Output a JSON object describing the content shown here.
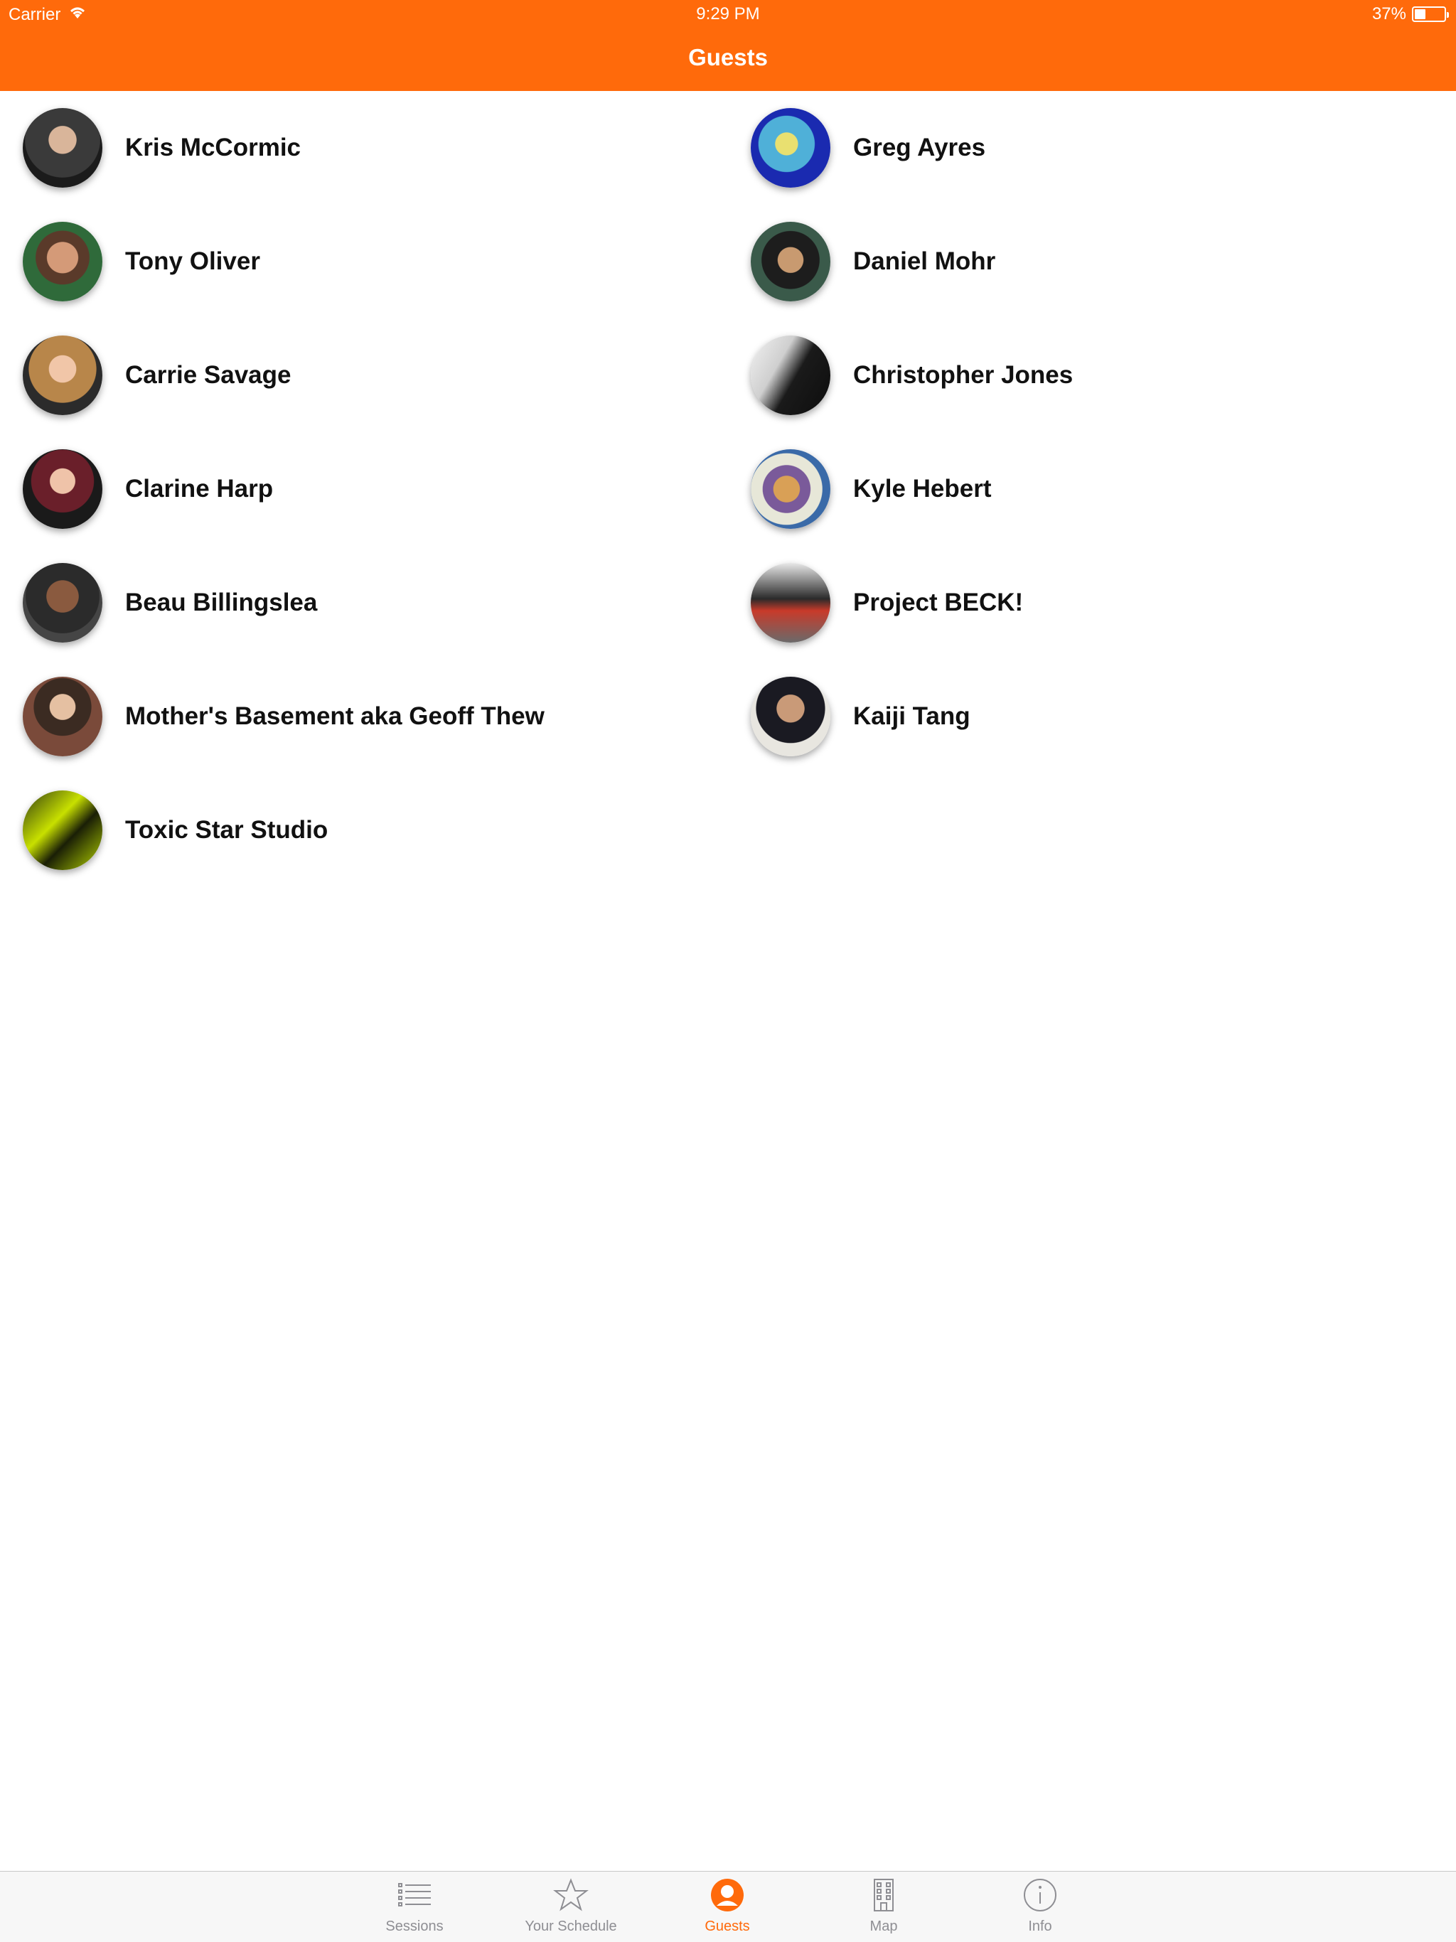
{
  "status_bar": {
    "carrier": "Carrier",
    "time": "9:29 PM",
    "battery": "37%"
  },
  "nav": {
    "title": "Guests"
  },
  "guests": [
    {
      "name": "Kris McCormic"
    },
    {
      "name": "Greg Ayres"
    },
    {
      "name": "Tony Oliver"
    },
    {
      "name": "Daniel Mohr"
    },
    {
      "name": "Carrie Savage"
    },
    {
      "name": "Christopher Jones"
    },
    {
      "name": "Clarine Harp"
    },
    {
      "name": "Kyle Hebert"
    },
    {
      "name": "Beau Billingslea"
    },
    {
      "name": "Project BECK!"
    },
    {
      "name": "Mother's Basement aka Geoff Thew"
    },
    {
      "name": "Kaiji Tang"
    },
    {
      "name": "Toxic Star Studio"
    }
  ],
  "tabs": [
    {
      "label": "Sessions",
      "icon": "list-icon"
    },
    {
      "label": "Your Schedule",
      "icon": "star-icon"
    },
    {
      "label": "Guests",
      "icon": "person-icon"
    },
    {
      "label": "Map",
      "icon": "building-icon"
    },
    {
      "label": "Info",
      "icon": "info-icon"
    }
  ],
  "colors": {
    "accent": "#FF6A0B",
    "tab_inactive": "#8e8e93"
  }
}
